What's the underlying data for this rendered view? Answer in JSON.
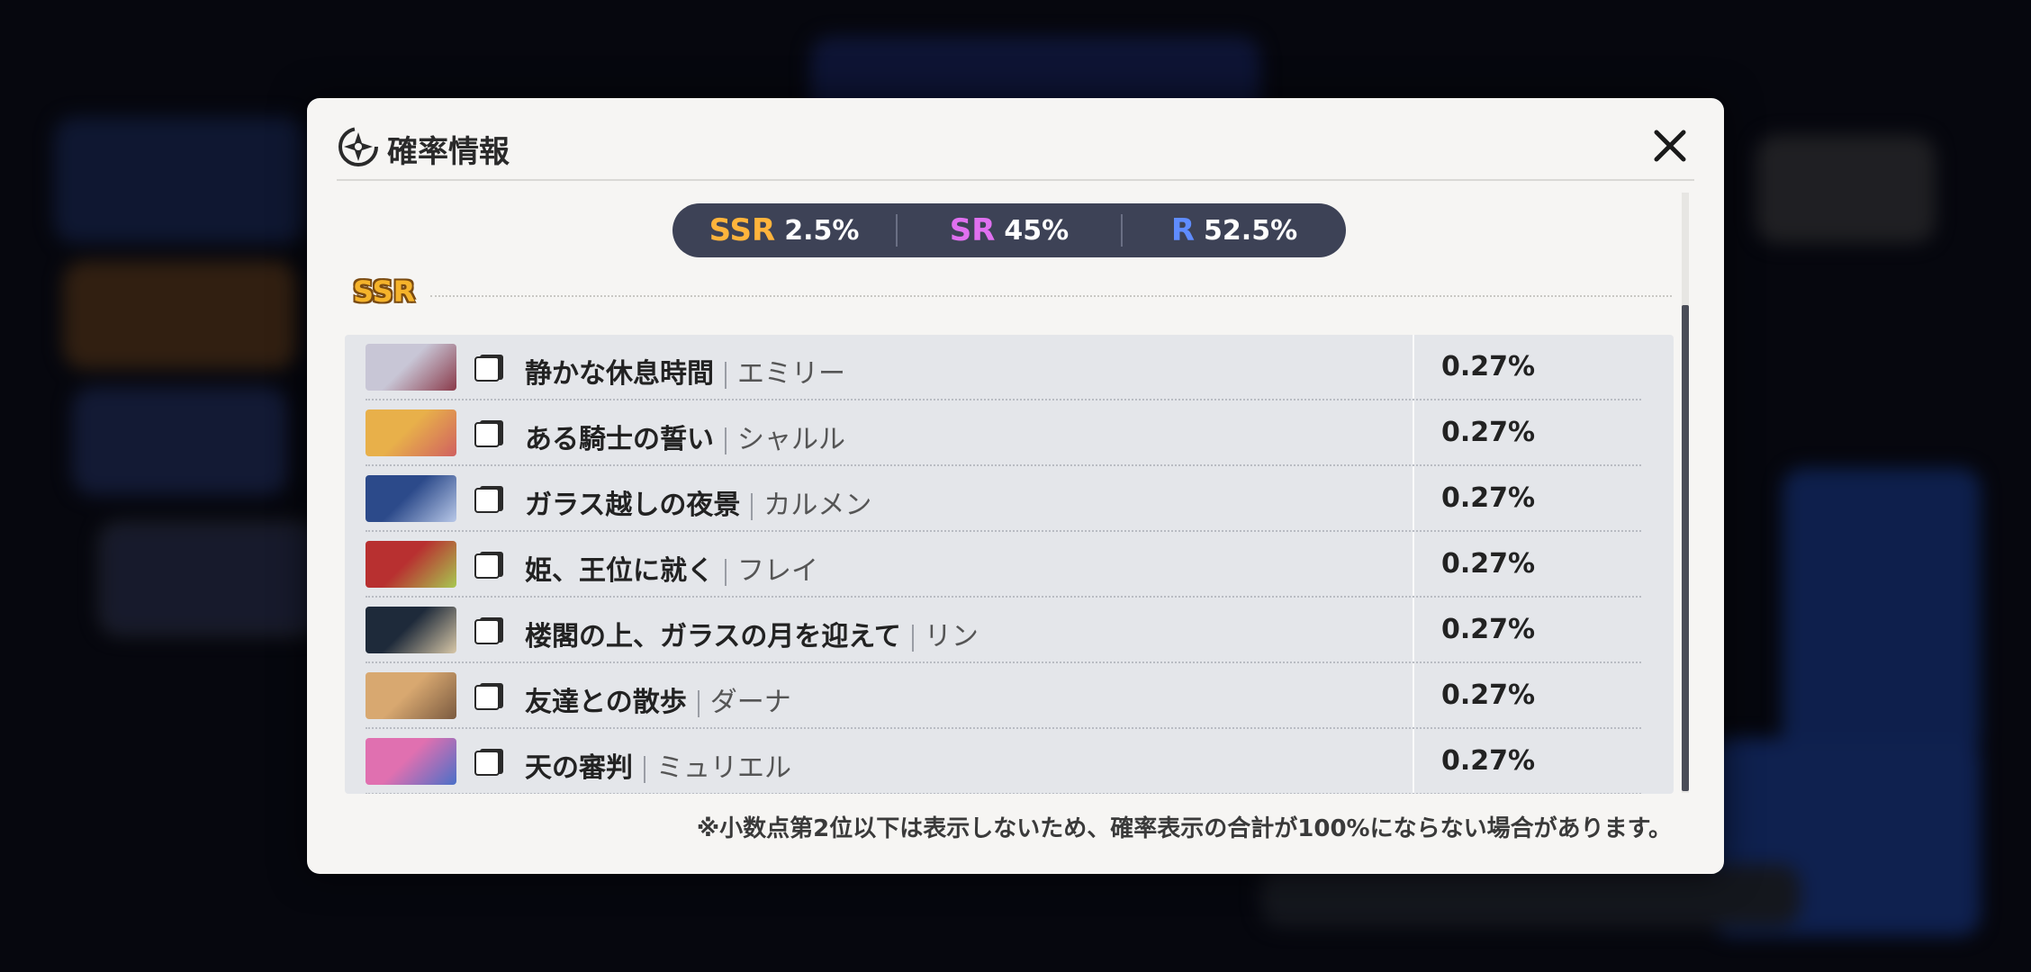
{
  "modal": {
    "title": "確率情報",
    "close_icon": "close-icon",
    "logo_icon": "compass-star-icon"
  },
  "rates": {
    "ssr_label": "SSR",
    "ssr_value": "2.5%",
    "sr_label": "SR",
    "sr_value": "45%",
    "r_label": "R",
    "r_value": "52.5%"
  },
  "section": {
    "label": "SSR"
  },
  "items": [
    {
      "title": "静かな休息時間",
      "character": "エミリー",
      "rate": "0.27%",
      "thumb_colors": [
        "#c8c6d6",
        "#8a3a4a"
      ]
    },
    {
      "title": "ある騎士の誓い",
      "character": "シャルル",
      "rate": "0.27%",
      "thumb_colors": [
        "#e8b04a",
        "#d06060"
      ]
    },
    {
      "title": "ガラス越しの夜景",
      "character": "カルメン",
      "rate": "0.27%",
      "thumb_colors": [
        "#2c4a8a",
        "#b8c8e8"
      ]
    },
    {
      "title": "姫、王位に就く",
      "character": "フレイ",
      "rate": "0.27%",
      "thumb_colors": [
        "#b83030",
        "#a8c850"
      ]
    },
    {
      "title": "楼閣の上、ガラスの月を迎えて",
      "character": "リン",
      "rate": "0.27%",
      "thumb_colors": [
        "#1e2a3a",
        "#d8c8a8"
      ]
    },
    {
      "title": "友達との散歩",
      "character": "ダーナ",
      "rate": "0.27%",
      "thumb_colors": [
        "#d8a870",
        "#7a5a40"
      ]
    },
    {
      "title": "天の審判",
      "character": "ミュリエル",
      "rate": "0.27%",
      "thumb_colors": [
        "#e070b0",
        "#4a70c8"
      ]
    }
  ],
  "footnote": "※小数点第2位以下は表示しないため、確率表示の合計が100%にならない場合があります。",
  "colors": {
    "ssr": "#ffb43c",
    "sr": "#e070f0",
    "r": "#5f8cff",
    "rate_bar": "#3d4256"
  }
}
